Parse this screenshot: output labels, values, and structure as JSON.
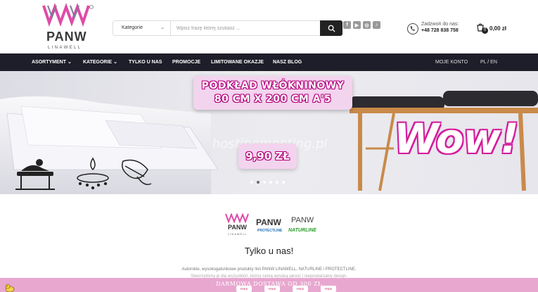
{
  "header": {
    "logo_text": "PANW",
    "logo_sub": "LINAWELL",
    "search": {
      "category_label": "Kategorie",
      "placeholder": "Wpisz frazę której szukasz ..."
    },
    "social_icons": [
      "facebook-icon",
      "youtube-icon",
      "instagram-icon",
      "tiktok-icon"
    ],
    "call": {
      "label": "Zadzwoń do nas:",
      "phone": "+48 728 838 758"
    },
    "cart": {
      "count": "0",
      "total": "0,00 zł"
    }
  },
  "nav": {
    "items": [
      {
        "label": "ASORTYMENT",
        "dropdown": true
      },
      {
        "label": "KATEGORIE",
        "dropdown": true
      },
      {
        "label": "TYLKO U NAS",
        "dropdown": false
      },
      {
        "label": "PROMOCJE",
        "dropdown": false
      },
      {
        "label": "LIMITOWANE OKAZJE",
        "dropdown": false
      },
      {
        "label": "NASZ BLOG",
        "dropdown": false
      }
    ],
    "account": "MOJE KONTO",
    "lang_pl": "PL",
    "lang_sep": "/",
    "lang_en": "EN"
  },
  "hero": {
    "headline_1": "PODKŁAD WŁÓKNINOWY",
    "headline_2": "80 CM X 200 CM  A'5",
    "price": "9,90 ZŁ",
    "wow": "Wow!",
    "watermark": "hostingmeeting.pl",
    "slide_count": 6,
    "active_slide": 2
  },
  "brands": {
    "items": [
      {
        "name": "PANW",
        "sub": "LINAWELL"
      },
      {
        "name": "PANW",
        "sub": "PROTECTLINE"
      },
      {
        "name": "PANW",
        "sub": "NATURLINE"
      }
    ]
  },
  "content": {
    "title": "Tylko u nas!",
    "text_1": "Autorskie, wysokogatunkowe produkty linii PANW LINAWELL, NATURLINE i PROTECTLINE.",
    "text_2": "Stworzyliśmy je dla wszystkich, którzy cenią wysoką jakość i niepowtarzalny design."
  },
  "bottom_bar": {
    "text": "DARMOWA DOSTAWA OD 300 ZŁ",
    "tag_label": "FREE"
  },
  "colors": {
    "nav_bg": "#1e1e2a",
    "accent_pink": "#d41c9c",
    "promo_bar": "#e8a7cf"
  }
}
